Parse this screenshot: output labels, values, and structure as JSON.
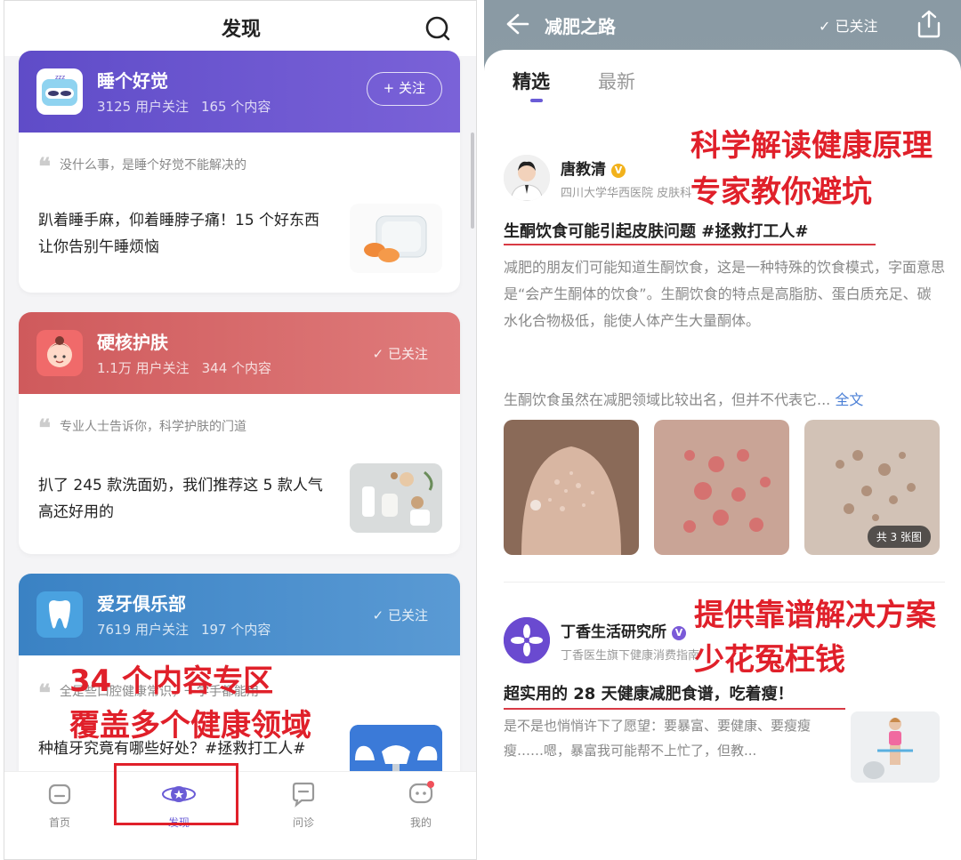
{
  "left": {
    "header_title": "发现",
    "communities": [
      {
        "name": "睡个好觉",
        "users": "3125 用户关注",
        "posts": "165 个内容",
        "action": "+ 关注",
        "quote": "没什么事，是睡个好觉不能解决的",
        "article": "趴着睡手麻，仰着睡脖子痛！15 个好东西让你告别午睡烦恼",
        "color": "#6a54d0"
      },
      {
        "name": "硬核护肤",
        "users": "1.1万 用户关注",
        "posts": "344 个内容",
        "action": "已关注",
        "quote": "专业人士告诉你，科学护肤的门道",
        "article": "扒了 245 款洗面奶，我们推荐这 5 款人气高还好用的",
        "color": "#d25a5a"
      },
      {
        "name": "爱牙俱乐部",
        "users": "7619 用户关注",
        "posts": "197 个内容",
        "action": "已关注",
        "quote": "全是些口腔健康常识，一学手都能用",
        "article": "种植牙究竟有哪些好处？#拯救打工人#",
        "color": "#3f86c8"
      }
    ],
    "tabs": [
      {
        "label": "首页",
        "icon": "home-icon"
      },
      {
        "label": "发现",
        "icon": "discover-icon"
      },
      {
        "label": "问诊",
        "icon": "consult-icon"
      },
      {
        "label": "我的",
        "icon": "profile-icon"
      }
    ],
    "annotation_line1": "34 个内容专区",
    "annotation_line2": "覆盖多个健康领域"
  },
  "right": {
    "header_title": "减肥之路",
    "followed": "已关注",
    "tabs": [
      "精选",
      "最新"
    ],
    "post1": {
      "author": "唐教清",
      "badge": "V",
      "affiliation": "四川大学华西医院 皮肤科",
      "title": "生酮饮食可能引起皮肤问题 #拯救打工人#",
      "body": "减肥的朋友们可能知道生酮饮食，这是一种特殊的饮食模式，字面意思是“会产生酮体的饮食”。生酮饮食的特点是高脂肪、蛋白质充足、碳水化合物极低，能使人体产生大量酮体。",
      "more": "生酮饮食虽然在减肥领域比较出名，但并不代表它...",
      "fulltext": "全文",
      "image_count": "共 3 张图"
    },
    "post2": {
      "author": "丁香生活研究所",
      "badge": "V",
      "affiliation": "丁香医生旗下健康消费指南",
      "title": "超实用的 28 天健康减肥食谱，吃着瘦！",
      "body": "是不是也悄悄许下了愿望：要暴富、要健康、要瘦瘦瘦……嗯，暴富我可能帮不上忙了，但教..."
    },
    "annotation1_line1": "科学解读健康原理",
    "annotation1_line2": "专家教你避坑",
    "annotation2_line1": "提供靠谱解决方案",
    "annotation2_line2": "少花冤枉钱"
  },
  "colors": {
    "accent": "#6a5cd6",
    "annotation_red": "#e0202a",
    "link_blue": "#4a7fd6"
  }
}
